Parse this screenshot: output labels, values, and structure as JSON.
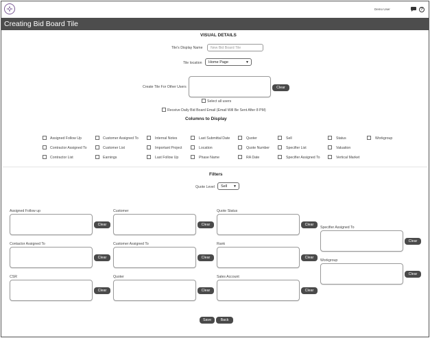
{
  "header": {
    "user_name": "Demo User",
    "title": "Creating Bid Board Tile"
  },
  "visual_details": {
    "heading": "VISUAL DETAILS",
    "display_name_label": "Tile's Display Name",
    "display_name_placeholder": "New Bid Board Tile",
    "location_label": "Tile location",
    "location_value": "Home Page",
    "other_users_label": "Create Tile For Other Users",
    "clear_label": "Clear",
    "select_all_label": "Select all users",
    "daily_email_label": "Receive Daily Bid Board Email (Email Will Be Sent After 8 PM)"
  },
  "columns": {
    "heading": "Columns to Display",
    "items": [
      "Assigned Follow Up",
      "Customer Assigned To",
      "Internal Notes",
      "Last Submittal Date",
      "Quoter",
      "Sell",
      "Status",
      "Workgroup",
      "Contractor Assigned To",
      "Customer List",
      "Important Project",
      "Location",
      "Quote Number",
      "Specifier List",
      "Valuation",
      "Contractor List",
      "Earnings",
      "Last Follow Up",
      "Phase Name",
      "RA Date",
      "Specifier Assigned To",
      "Vertical Market"
    ]
  },
  "filters": {
    "heading": "Filters",
    "quote_level_label": "Quote Level",
    "quote_level_value": "Sell",
    "clear_label": "Clear",
    "fields": [
      "Assigned Follow up",
      "Customer",
      "Quote Status",
      "Specifier Assigned To",
      "Contactor Assigned To",
      "Customer Assigned To",
      "Rank",
      "Workgroup",
      "CSR",
      "Quoter",
      "Sales Account"
    ]
  },
  "actions": {
    "save_label": "Save",
    "back_label": "Back"
  },
  "colors": {
    "title_bar": "#4d4d4d",
    "button": "#4a4a4a",
    "logo": "#7a5a95"
  }
}
